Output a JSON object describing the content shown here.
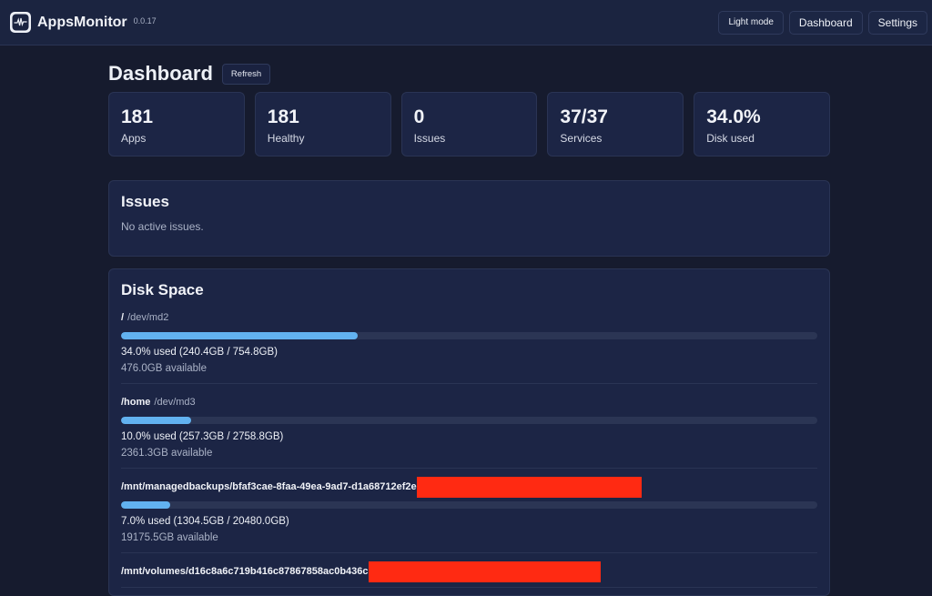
{
  "app": {
    "name": "AppsMonitor",
    "version": "0.0.17"
  },
  "nav": {
    "light_mode": "Light mode",
    "dashboard": "Dashboard",
    "settings": "Settings"
  },
  "page": {
    "title": "Dashboard",
    "refresh": "Refresh"
  },
  "stats": [
    {
      "value": "181",
      "label": "Apps"
    },
    {
      "value": "181",
      "label": "Healthy"
    },
    {
      "value": "0",
      "label": "Issues"
    },
    {
      "value": "37/37",
      "label": "Services"
    },
    {
      "value": "34.0%",
      "label": "Disk used"
    }
  ],
  "issues": {
    "title": "Issues",
    "empty": "No active issues."
  },
  "disk": {
    "title": "Disk Space",
    "entries": [
      {
        "mount": "/",
        "device": "/dev/md2",
        "percent": 34.0,
        "used": "34.0% used (240.4GB / 754.8GB)",
        "available": "476.0GB available"
      },
      {
        "mount": "/home",
        "device": "/dev/md3",
        "percent": 10.0,
        "used": "10.0% used (257.3GB / 2758.8GB)",
        "available": "2361.3GB available"
      },
      {
        "mount": "/mnt/managedbackups/bfaf3cae-8faa-49ea-9ad7-d1a68712ef2e",
        "device": "",
        "percent": 7.0,
        "used": "7.0% used (1304.5GB / 20480.0GB)",
        "available": "19175.5GB available"
      },
      {
        "mount": "/mnt/volumes/d16c8a6c719b416c87867858ac0b436c",
        "device": "",
        "percent": 0,
        "used": "",
        "available": ""
      }
    ]
  },
  "colors": {
    "accent": "#62b2f0",
    "redaction": "#ff2a12"
  }
}
